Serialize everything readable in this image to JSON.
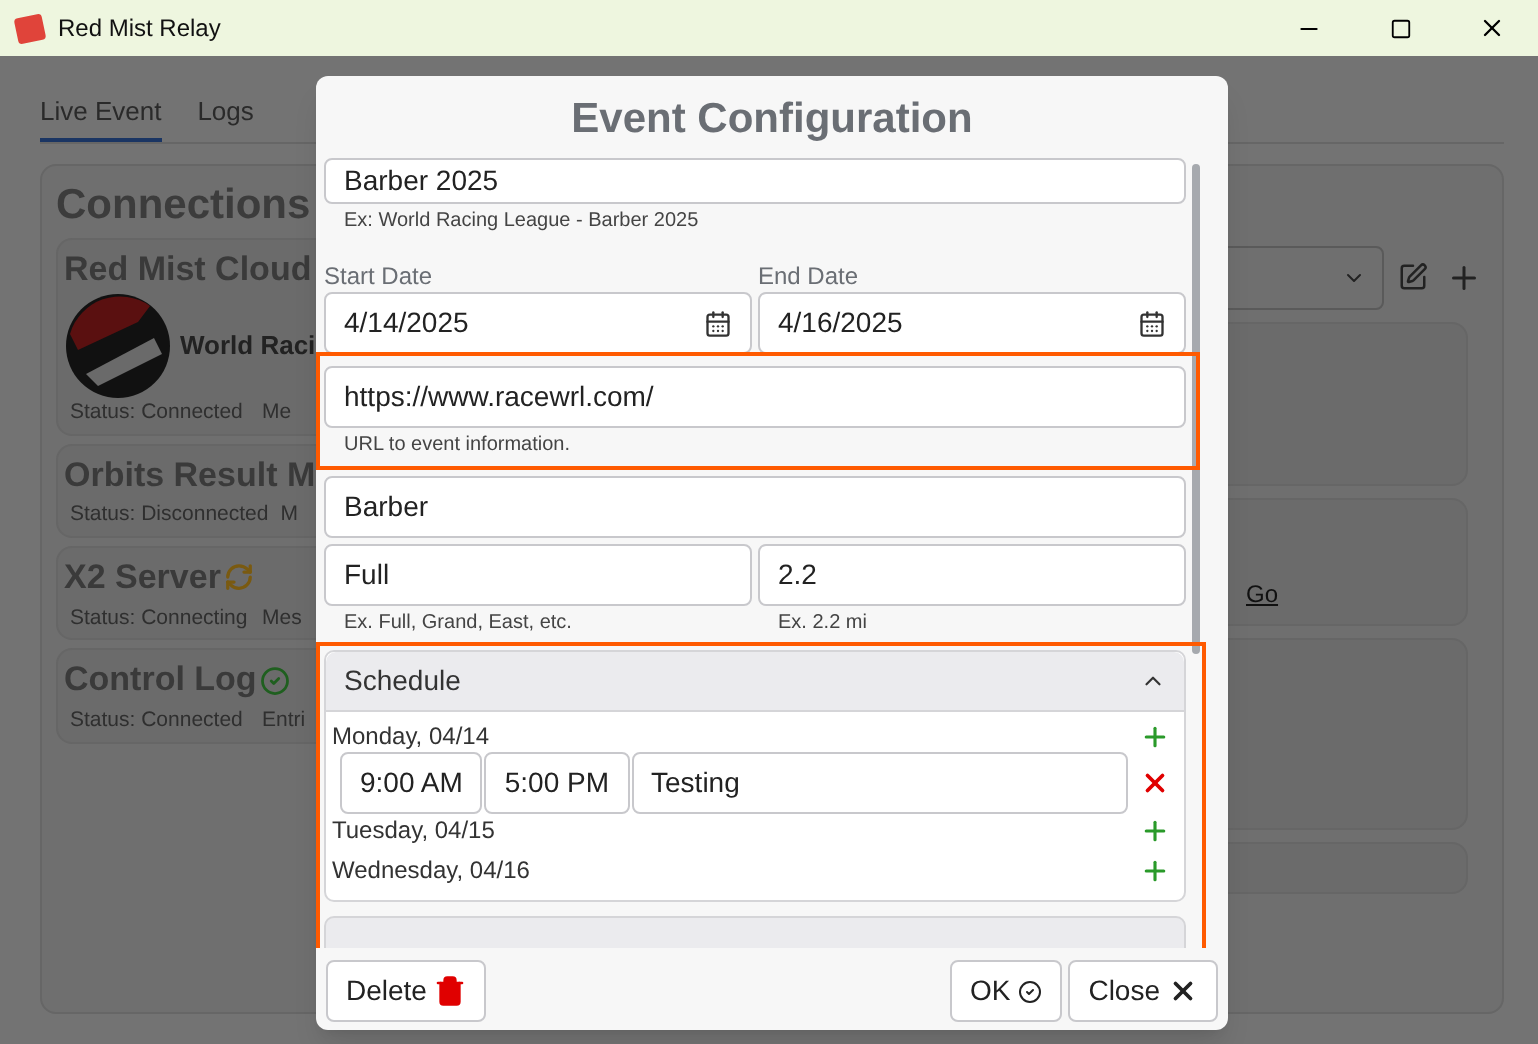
{
  "window": {
    "title": "Red Mist Relay"
  },
  "tabs": [
    {
      "label": "Live Event",
      "selected": true
    },
    {
      "label": "Logs",
      "selected": false
    }
  ],
  "connections": {
    "title": "Connections",
    "items": [
      {
        "name": "Red Mist Cloud",
        "kind": "connected",
        "org": "World Raci",
        "status": "Status: Connected",
        "detail": "Me"
      },
      {
        "name": "Orbits Result M",
        "kind": "none",
        "status": "Status: Disconnected",
        "detail": "M"
      },
      {
        "name": "X2 Server",
        "kind": "connecting",
        "status": "Status: Connecting",
        "detail": "Mes"
      },
      {
        "name": "Control Log",
        "kind": "connected",
        "status": "Status: Connected",
        "detail": "Entri"
      }
    ]
  },
  "right_panel": {
    "link": "Go"
  },
  "dialog": {
    "title": "Event Configuration",
    "name": {
      "value": "Barber 2025",
      "hint": "Ex: World Racing League - Barber 2025"
    },
    "start_date": {
      "label": "Start Date",
      "value": "4/14/2025"
    },
    "end_date": {
      "label": "End Date",
      "value": "4/16/2025"
    },
    "url": {
      "value": "https://www.racewrl.com/",
      "hint": "URL to event information.",
      "highlighted": true
    },
    "track": {
      "value": "Barber"
    },
    "course": {
      "value": "Full",
      "hint": "Ex. Full, Grand, East, etc."
    },
    "distance": {
      "value": "2.2",
      "hint": "Ex. 2.2 mi"
    },
    "schedule": {
      "title": "Schedule",
      "expanded": true,
      "highlighted": true,
      "days": [
        {
          "label": "Monday, 04/14",
          "entries": [
            {
              "start": "9:00 AM",
              "end": "5:00 PM",
              "name": "Testing"
            }
          ]
        },
        {
          "label": "Tuesday, 04/15"
        },
        {
          "label": "Wednesday, 04/16"
        }
      ]
    },
    "buttons": [
      {
        "label": "Delete",
        "kind": "delete"
      },
      {
        "label": "OK",
        "kind": "ok"
      },
      {
        "label": "Close",
        "kind": "close"
      }
    ]
  }
}
